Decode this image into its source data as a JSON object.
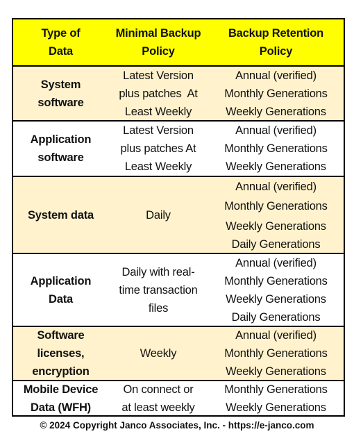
{
  "table": {
    "headers": [
      [
        "Type of",
        "Data"
      ],
      [
        "Minimal Backup",
        "Policy"
      ],
      [
        "Backup Retention",
        "Policy"
      ]
    ],
    "rows": [
      {
        "type": [
          "System",
          "software"
        ],
        "minimal": [
          "Latest Version",
          "plus patches  At",
          "Least Weekly"
        ],
        "retention": [
          "Annual (verified)",
          "Monthly Generations",
          "Weekly Generations"
        ]
      },
      {
        "type": [
          "Application",
          "software"
        ],
        "minimal": [
          "Latest Version",
          "plus patches At",
          "Least Weekly"
        ],
        "retention": [
          "Annual (verified)",
          "Monthly Generations",
          "Weekly Generations"
        ]
      },
      {
        "type": [
          "System data"
        ],
        "minimal": [
          "Daily"
        ],
        "retention": [
          "Annual (verified)",
          "Monthly Generations",
          "Weekly Generations",
          "Daily Generations"
        ]
      },
      {
        "type": [
          "Application",
          "Data"
        ],
        "minimal": [
          "Daily with real-",
          "time transaction",
          "files"
        ],
        "retention": [
          "Annual (verified)",
          "Monthly Generations",
          "Weekly Generations",
          "Daily Generations"
        ]
      },
      {
        "type": [
          "Software",
          "licenses,",
          "encryption"
        ],
        "minimal": [
          "Weekly"
        ],
        "retention": [
          "Annual (verified)",
          "Monthly Generations",
          "Weekly Generations"
        ]
      },
      {
        "type": [
          "Mobile Device",
          "Data (WFH)"
        ],
        "minimal": [
          "On connect or",
          "at least weekly"
        ],
        "retention": [
          "Monthly Generations",
          "Weekly Generations"
        ]
      }
    ]
  },
  "colors": {
    "header_bg": "#ffff00",
    "shaded_row_bg": "#fff2cc",
    "plain_row_bg": "#ffffff",
    "border": "#000000"
  },
  "footer": {
    "copyright": "© 2024 Copyright Janco Associates, Inc. - https://e-janco.com"
  }
}
